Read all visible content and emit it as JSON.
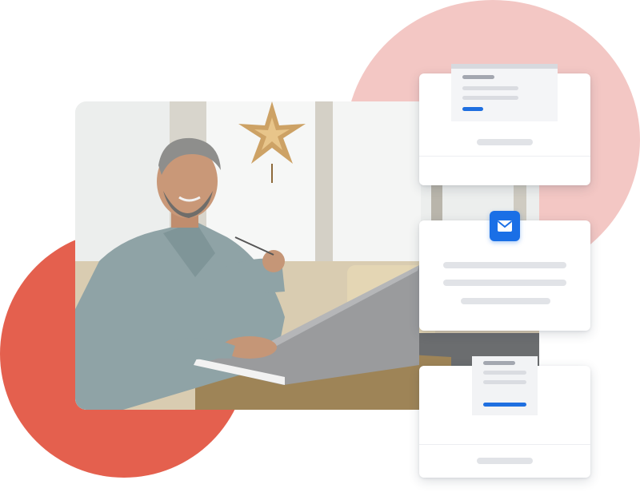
{
  "colors": {
    "pink_blob": "#f3c7c4",
    "coral_blob": "#e4604e",
    "accent_blue": "#1a6fe6",
    "card_bg": "#ffffff",
    "placeholder_gray": "#dadce1"
  },
  "illustration": {
    "photo_subject": "photo-man-with-laptop",
    "cards": [
      {
        "kind": "document-preview-card"
      },
      {
        "kind": "email-card",
        "icon": "mail-icon"
      },
      {
        "kind": "document-preview-card"
      }
    ]
  }
}
